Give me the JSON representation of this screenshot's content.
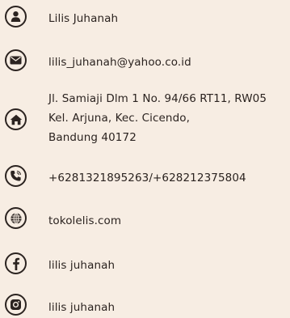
{
  "contacts": {
    "name": "Lilis Juhanah",
    "email": "lilis_juhanah@yahoo.co.id",
    "address": {
      "line1": "Jl. Samiaji Dlm 1 No. 94/66 RT11, RW05",
      "line2": "Kel. Arjuna, Kec. Cicendo,",
      "line3": "Bandung 40172"
    },
    "phone": "+6281321895263/+628212375804",
    "website": "tokolelis.com",
    "facebook": "lilis juhanah",
    "instagram": "lilis juhanah"
  },
  "icons": [
    "user-icon",
    "email-icon",
    "home-icon",
    "phone-icon",
    "globe-icon",
    "facebook-icon",
    "instagram-icon"
  ],
  "colors": {
    "background": "#f7ede3",
    "foreground": "#2b2320"
  }
}
